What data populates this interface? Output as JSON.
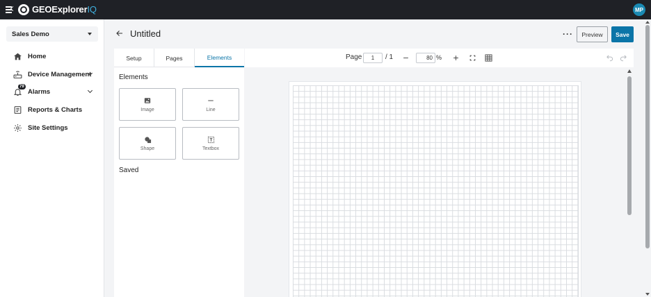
{
  "app": {
    "brand_main": "GEOExplorer",
    "brand_suffix": "IQ",
    "user_initials": "MP",
    "accent_color": "#0b75a8"
  },
  "sidebar": {
    "site": "Sales Demo",
    "items": [
      {
        "label": "Home",
        "icon": "home-icon"
      },
      {
        "label": "Device Management",
        "icon": "device-icon",
        "expandable": true
      },
      {
        "label": "Alarms",
        "icon": "bell-icon",
        "badge": "79",
        "expandable": true
      },
      {
        "label": "Reports & Charts",
        "icon": "report-icon"
      },
      {
        "label": "Site Settings",
        "icon": "gear-icon"
      }
    ]
  },
  "header": {
    "title": "Untitled",
    "preview_label": "Preview",
    "save_label": "Save"
  },
  "panel": {
    "tabs": [
      {
        "label": "Setup",
        "active": false
      },
      {
        "label": "Pages",
        "active": false
      },
      {
        "label": "Elements",
        "active": true
      }
    ],
    "elements_heading": "Elements",
    "elements": [
      {
        "label": "Image",
        "icon": "image-icon"
      },
      {
        "label": "Line",
        "icon": "line-icon"
      },
      {
        "label": "Shape",
        "icon": "shape-icon"
      },
      {
        "label": "Textbox",
        "icon": "textbox-icon"
      }
    ],
    "saved_heading": "Saved"
  },
  "toolbar": {
    "page_label": "Page",
    "page_value": "1",
    "page_total": "/ 1",
    "zoom_value": "80",
    "zoom_unit": "%"
  }
}
